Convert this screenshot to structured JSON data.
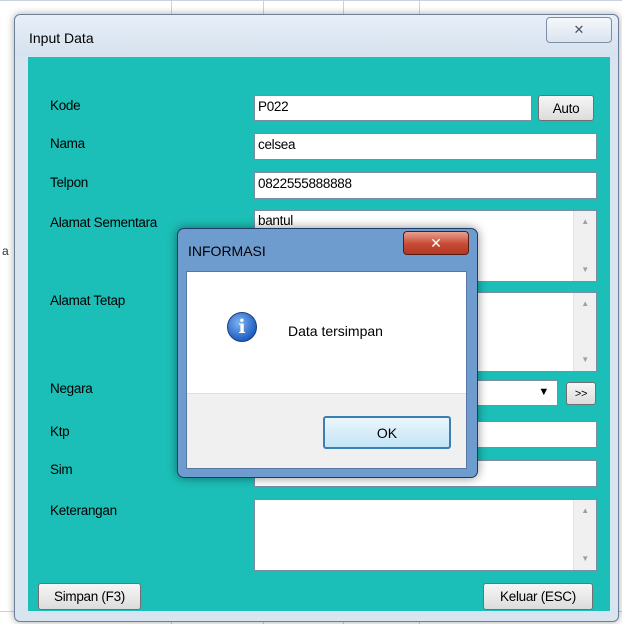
{
  "window": {
    "title": "Input Data",
    "close_symbol": "✕"
  },
  "form": {
    "kode_label": "Kode",
    "kode_value": "P022",
    "auto_button": "Auto",
    "nama_label": "Nama",
    "nama_value": "celsea",
    "telpon_label": "Telpon",
    "telpon_value": "0822555888888",
    "alamat_sementara_label": "Alamat Sementara",
    "alamat_sementara_value": "bantul",
    "alamat_tetap_label": "Alamat Tetap",
    "alamat_tetap_value": "",
    "negara_label": "Negara",
    "negara_value": "",
    "negara_button": ">>",
    "ktp_label": "Ktp",
    "ktp_value": "",
    "sim_label": "Sim",
    "sim_value": "",
    "keterangan_label": "Keterangan",
    "keterangan_value": "",
    "simpan_button": "Simpan (F3)",
    "keluar_button": "Keluar (ESC)"
  },
  "dialog": {
    "title": "INFORMASI",
    "close_symbol": "✕",
    "message": "Data tersimpan",
    "icon": "info-icon",
    "icon_glyph": "i",
    "ok_button": "OK"
  },
  "background": {
    "row_letter": "a"
  },
  "colors": {
    "form_background": "#1bbfb7",
    "dialog_frame": "#6f9ccf",
    "dialog_close": "#c74a33"
  }
}
